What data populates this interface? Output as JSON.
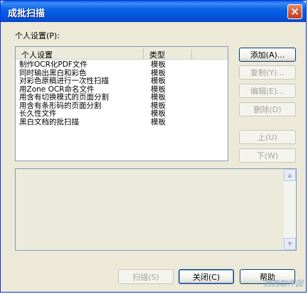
{
  "window": {
    "title": "成批扫描",
    "close_glyph": "×"
  },
  "profiles": {
    "label": "个人设置",
    "label_key": "(P):",
    "columns": [
      "个人设置",
      "类型"
    ],
    "rows": [
      {
        "name": "制作OCR化PDF文件",
        "type": "模板"
      },
      {
        "name": "同时输出黑白和彩色",
        "type": "模板"
      },
      {
        "name": "对彩色原稿进行一次性扫描",
        "type": "模板"
      },
      {
        "name": "用Zone OCR命名文件",
        "type": "模板"
      },
      {
        "name": "用含有切换模式的页面分割",
        "type": "模板"
      },
      {
        "name": "用含有条形码的页面分割",
        "type": "模板"
      },
      {
        "name": "长久性文件",
        "type": "模板"
      },
      {
        "name": "黑白文档的批扫描",
        "type": "模板"
      }
    ]
  },
  "side_buttons": {
    "add": "添加(A)...",
    "copy": "复制(Y)...",
    "edit": "编辑(E)...",
    "delete": "删除(D)",
    "up": "上(U)",
    "down": "下(W)"
  },
  "scrollbar": {
    "up_glyph": "▲",
    "down_glyph": "▼"
  },
  "bottom_buttons": {
    "scan": "扫描(S)",
    "close": "关闭(C)",
    "help": "帮助"
  },
  "watermark": "西西软件园"
}
